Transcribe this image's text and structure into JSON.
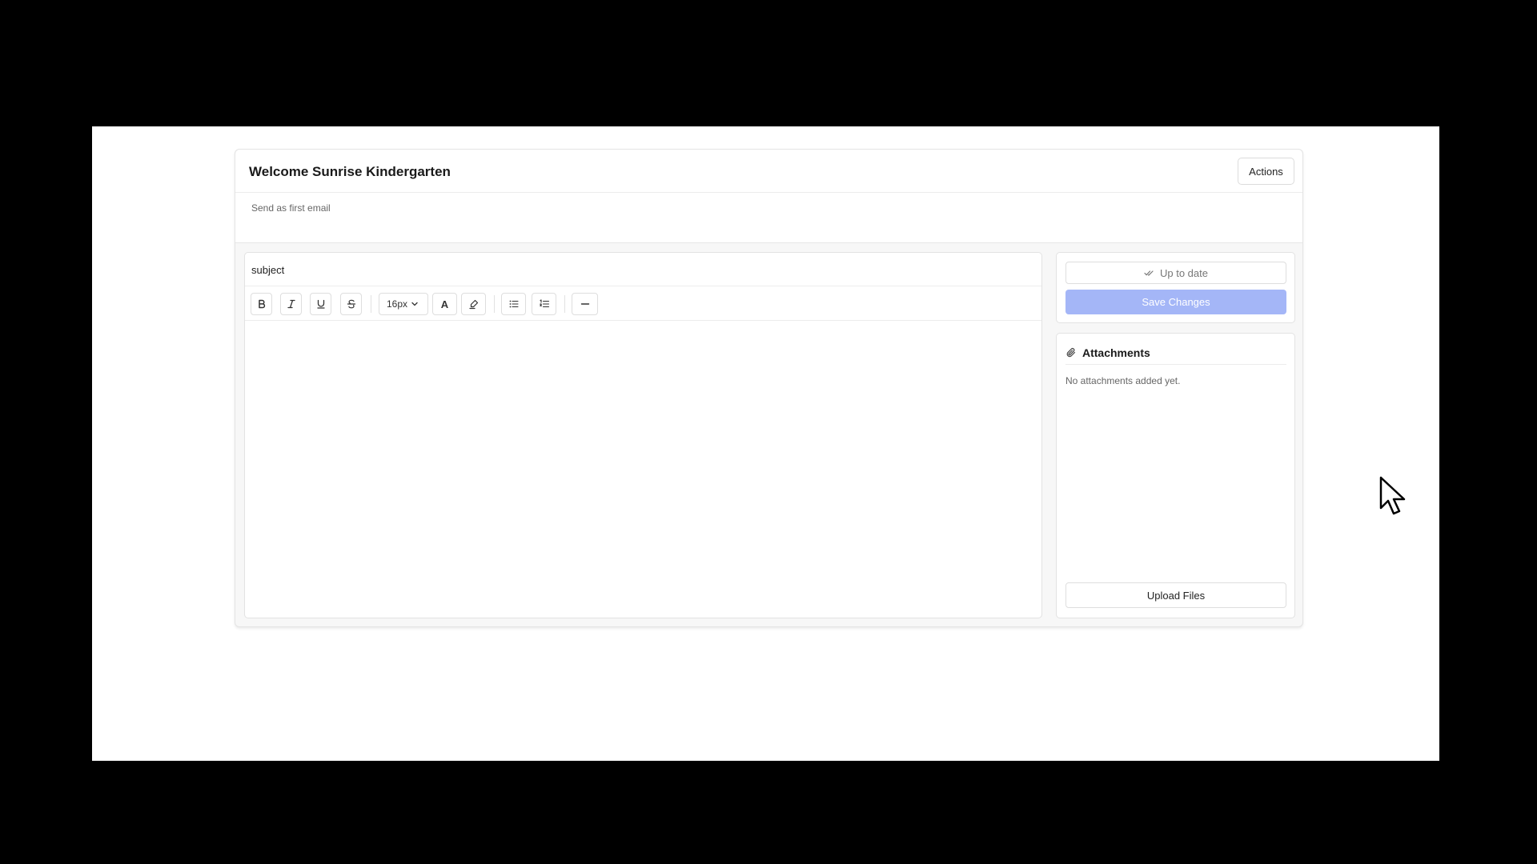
{
  "header": {
    "title": "Welcome Sunrise Kindergarten",
    "actions_label": "Actions",
    "description": "Send as first email"
  },
  "editor": {
    "subject_value": "subject",
    "toolbar": {
      "font_size": "16px",
      "text_color_label": "A",
      "buttons": [
        "bold-icon",
        "italic-icon",
        "underline-icon",
        "strikethrough-icon",
        "font-size-select",
        "text-color-icon",
        "highlight-icon",
        "bullet-list-icon",
        "ordered-list-icon",
        "horizontal-rule-icon"
      ]
    },
    "body": ""
  },
  "status": {
    "uptodate_label": "Up to date",
    "save_label": "Save Changes"
  },
  "attachments": {
    "title": "Attachments",
    "empty_text": "No attachments added yet.",
    "upload_label": "Upload Files"
  },
  "colors": {
    "save_button_bg": "#a4b6f7",
    "letterbox": "#000000"
  }
}
